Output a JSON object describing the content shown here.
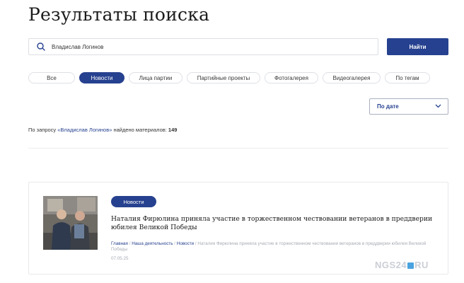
{
  "header": {
    "title": "Результаты поиска"
  },
  "search": {
    "value": "Владислав Логинов",
    "button_label": "Найти"
  },
  "tabs": [
    {
      "label": "Все",
      "active": false
    },
    {
      "label": "Новости",
      "active": true
    },
    {
      "label": "Лица партии",
      "active": false
    },
    {
      "label": "Партийные проекты",
      "active": false
    },
    {
      "label": "Фотогалерея",
      "active": false
    },
    {
      "label": "Видеогалерея",
      "active": false
    },
    {
      "label": "По тегам",
      "active": false
    }
  ],
  "sort": {
    "selected": "По дате"
  },
  "results": {
    "prefix": "По запросу ",
    "query": "«Владислав Логинов»",
    "middle": " найдено материалов: ",
    "count": "149"
  },
  "card": {
    "badge": "Новости",
    "title": "Наталия Фирюлина приняла участие в торжественном чествовании ветеранов в преддверии юбилея Великой Победы",
    "breadcrumb": {
      "home": "Главная",
      "section": "Наша деятельность",
      "category": "Новости",
      "current": "Наталия Фирюлина приняла участие в торжественном чествовании ветеранов в преддверии юбилея Великой Победы"
    },
    "date": "07.05.25"
  },
  "watermark": {
    "left": "NGS24",
    "right": "RU"
  },
  "colors": {
    "accent": "#26418f",
    "muted": "#a7abb4",
    "border": "#dde0e6"
  }
}
